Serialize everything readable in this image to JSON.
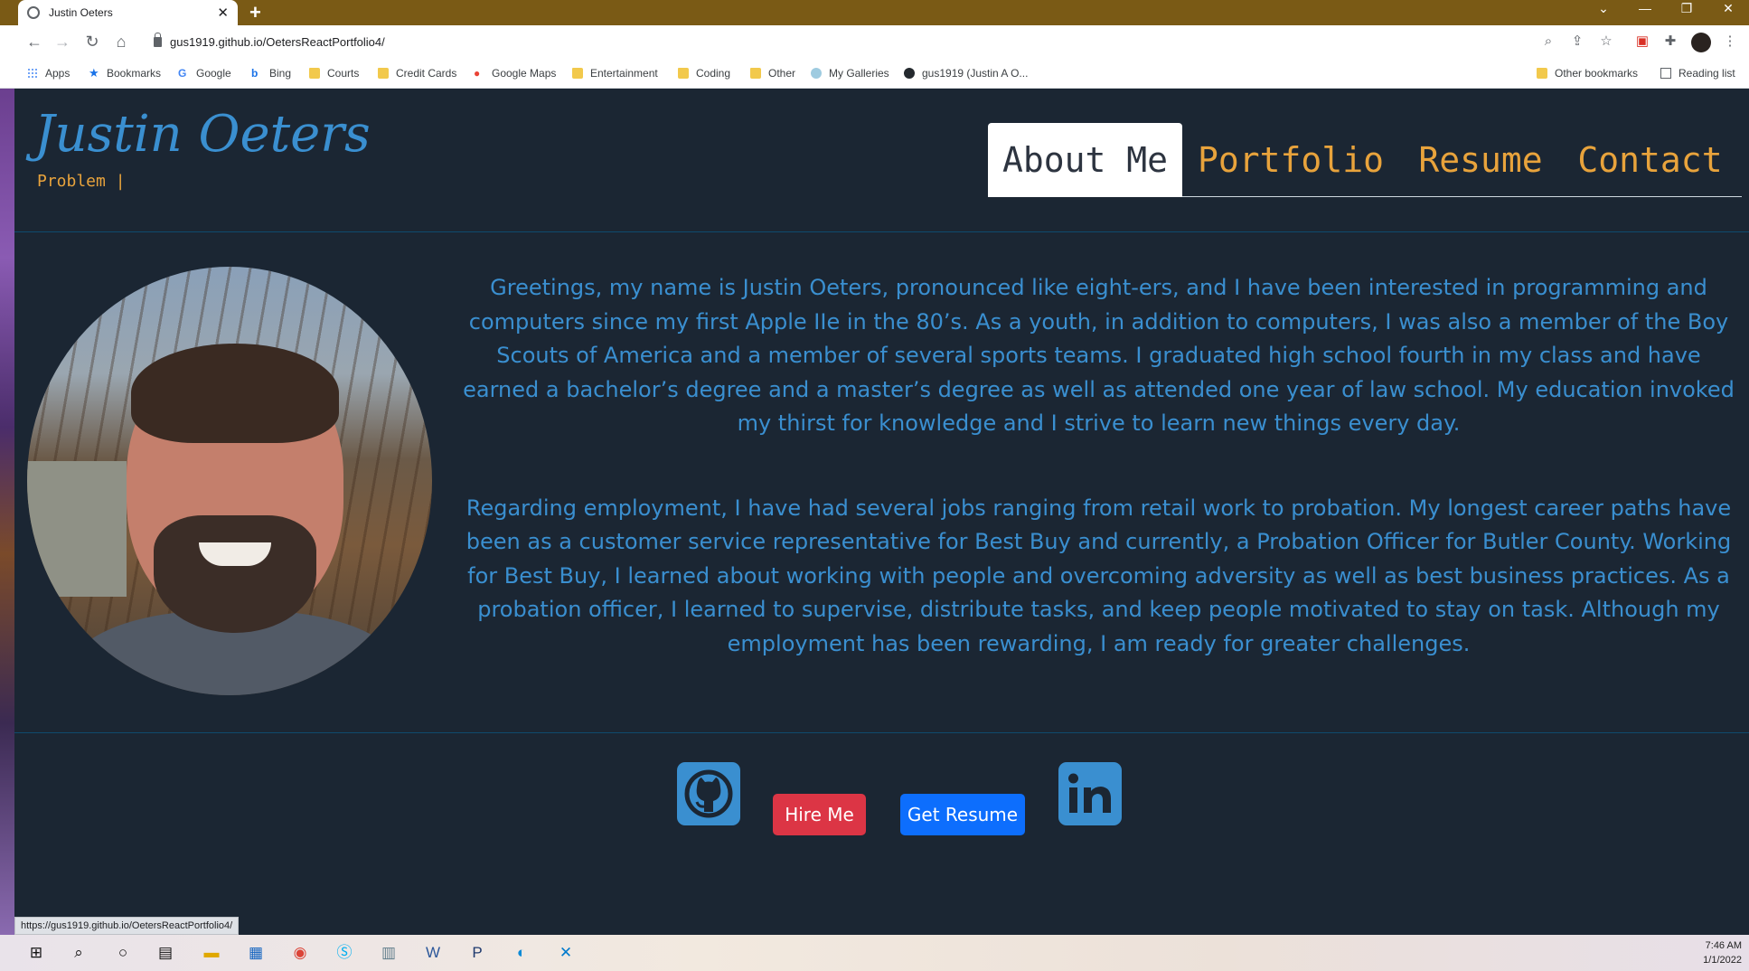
{
  "browser": {
    "tab_title": "Justin Oeters",
    "new_tab_symbol": "+",
    "tab_close_symbol": "✕",
    "url": "gus1919.github.io/OetersReactPortfolio4/",
    "window_controls": {
      "dropdown": "⌄",
      "minimize": "—",
      "restore": "❐",
      "close": "✕"
    },
    "bookmarks": [
      {
        "label": "Apps",
        "icon": "apps-grid-icon"
      },
      {
        "label": "Bookmarks",
        "icon": "star-icon"
      },
      {
        "label": "Google",
        "icon": "google-icon"
      },
      {
        "label": "Bing",
        "icon": "bing-icon"
      },
      {
        "label": "Courts",
        "icon": "folder-icon"
      },
      {
        "label": "Credit Cards",
        "icon": "folder-icon"
      },
      {
        "label": "Google Maps",
        "icon": "maps-pin-icon"
      },
      {
        "label": "Entertainment",
        "icon": "folder-icon"
      },
      {
        "label": "Coding",
        "icon": "folder-icon"
      },
      {
        "label": "Other",
        "icon": "folder-icon"
      },
      {
        "label": "My Galleries",
        "icon": "galleries-icon"
      },
      {
        "label": "gus1919 (Justin A O...",
        "icon": "github-icon"
      }
    ],
    "other_bookmarks": "Other bookmarks",
    "reading_list": "Reading list",
    "status_link": "https://gus1919.github.io/OetersReactPortfolio4/"
  },
  "site": {
    "brand": "Justin Oeters",
    "typed_text": "Problem |",
    "nav": [
      "About Me",
      "Portfolio",
      "Resume",
      "Contact"
    ],
    "active_nav": "About Me",
    "bio": [
      "Greetings, my name is Justin Oeters, pronounced like eight-ers, and I have been interested in programming and computers since my first Apple IIe in the 80’s. As a youth, in addition to computers, I was also a member of the Boy Scouts of America and a member of several sports teams. I graduated high school fourth in my class and have earned a bachelor’s degree and a master’s degree as well as attended one year of law school. My education invoked my thirst for knowledge and I strive to learn new things every day.",
      "Regarding employment, I have had several jobs ranging from retail work to probation. My longest career paths have been as a customer service representative for Best Buy and currently, a Probation Officer for Butler County. Working for Best Buy, I learned about working with people and overcoming adversity as well as best business practices. As a probation officer, I learned to supervise, distribute tasks, and keep people motivated to stay on task. Although my employment has been rewarding, I am ready for greater challenges."
    ],
    "buttons": {
      "hire": "Hire Me",
      "resume": "Get Resume"
    },
    "colors": {
      "brand_blue": "#3a8fd0",
      "accent_orange": "#e8a33c",
      "page_bg": "#1b2633",
      "hire_red": "#dc3545",
      "resume_blue": "#0d6efd"
    }
  },
  "taskbar": {
    "time": "7:46 AM",
    "date": "1/1/2022"
  }
}
